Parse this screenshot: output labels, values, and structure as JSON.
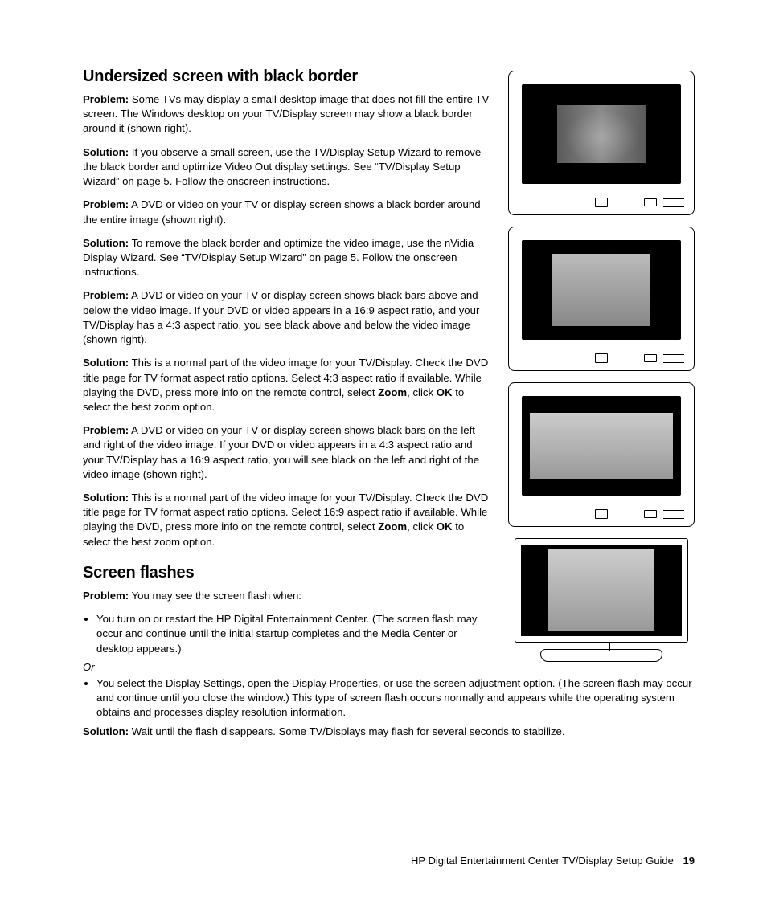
{
  "section1": {
    "title": "Undersized screen with black border",
    "p1_lead": "Problem:",
    "p1_text": " Some TVs may display a small desktop image that does not fill the entire TV screen. The Windows desktop on your TV/Display screen may show a black border around it (shown right).",
    "p2_lead": "Solution:",
    "p2_text": " If you observe a small screen, use the TV/Display Setup Wizard to remove the black border and optimize Video Out display settings. See “TV/Display Setup Wizard” on page 5. Follow the onscreen instructions.",
    "p3_lead": "Problem:",
    "p3_text": " A DVD or video on your TV or display screen shows a black border around the entire image (shown right).",
    "p4_lead": "Solution:",
    "p4_text": " To remove the black border and optimize the video image, use the nVidia Display Wizard. See “TV/Display Setup Wizard” on page 5. Follow the onscreen instructions.",
    "p5_lead": "Problem:",
    "p5_text": " A DVD or video on your TV or display screen shows black bars above and below the video image. If your DVD or video appears in a 16:9 aspect ratio, and your TV/Display has a 4:3 aspect ratio, you see black above and below the video image (shown right).",
    "p6_lead": "Solution:",
    "p6_text_a": " This is a normal part of the video image for your TV/Display. Check the DVD title page for TV format aspect ratio options. Select 4:3 aspect ratio if available. While playing the DVD, press more info on the remote control, select ",
    "p6_zoom": "Zoom",
    "p6_text_b": ", click ",
    "p6_ok": "OK",
    "p6_text_c": " to select the best zoom option.",
    "p7_lead": "Problem:",
    "p7_text": " A DVD or video on your TV or display screen shows black bars on the left and right of the video image. If your DVD or video appears in a 4:3 aspect ratio and your TV/Display has a 16:9 aspect ratio, you will see black on the left and right of the video image (shown right).",
    "p8_lead": "Solution:",
    "p8_text_a": " This is a normal part of the video image for your TV/Display. Check the DVD title page for TV format aspect ratio options. Select 16:9 aspect ratio if available. While playing the DVD, press more info on the remote control, select ",
    "p8_zoom": "Zoom",
    "p8_text_b": ", click ",
    "p8_ok": "OK",
    "p8_text_c": " to select the best zoom option."
  },
  "section2": {
    "title": "Screen flashes",
    "p1_lead": "Problem:",
    "p1_text": " You may see the screen flash when:",
    "bullet1": "You turn on or restart the HP Digital Entertainment Center. (The screen flash may occur and continue until the initial startup completes and the Media Center or desktop appears.)",
    "or": "Or",
    "bullet2": "You select the Display Settings, open the Display Properties, or use the screen adjustment option. (The screen flash may occur and continue until you close the window.) This type of screen flash occurs normally and appears while the operating system obtains and processes display resolution information.",
    "p2_lead": "Solution:",
    "p2_text": " Wait until the flash disappears. Some TV/Displays may flash for several seconds to stabilize."
  },
  "footer": {
    "text": "HP Digital Entertainment Center TV/Display Setup Guide",
    "page": "19"
  }
}
